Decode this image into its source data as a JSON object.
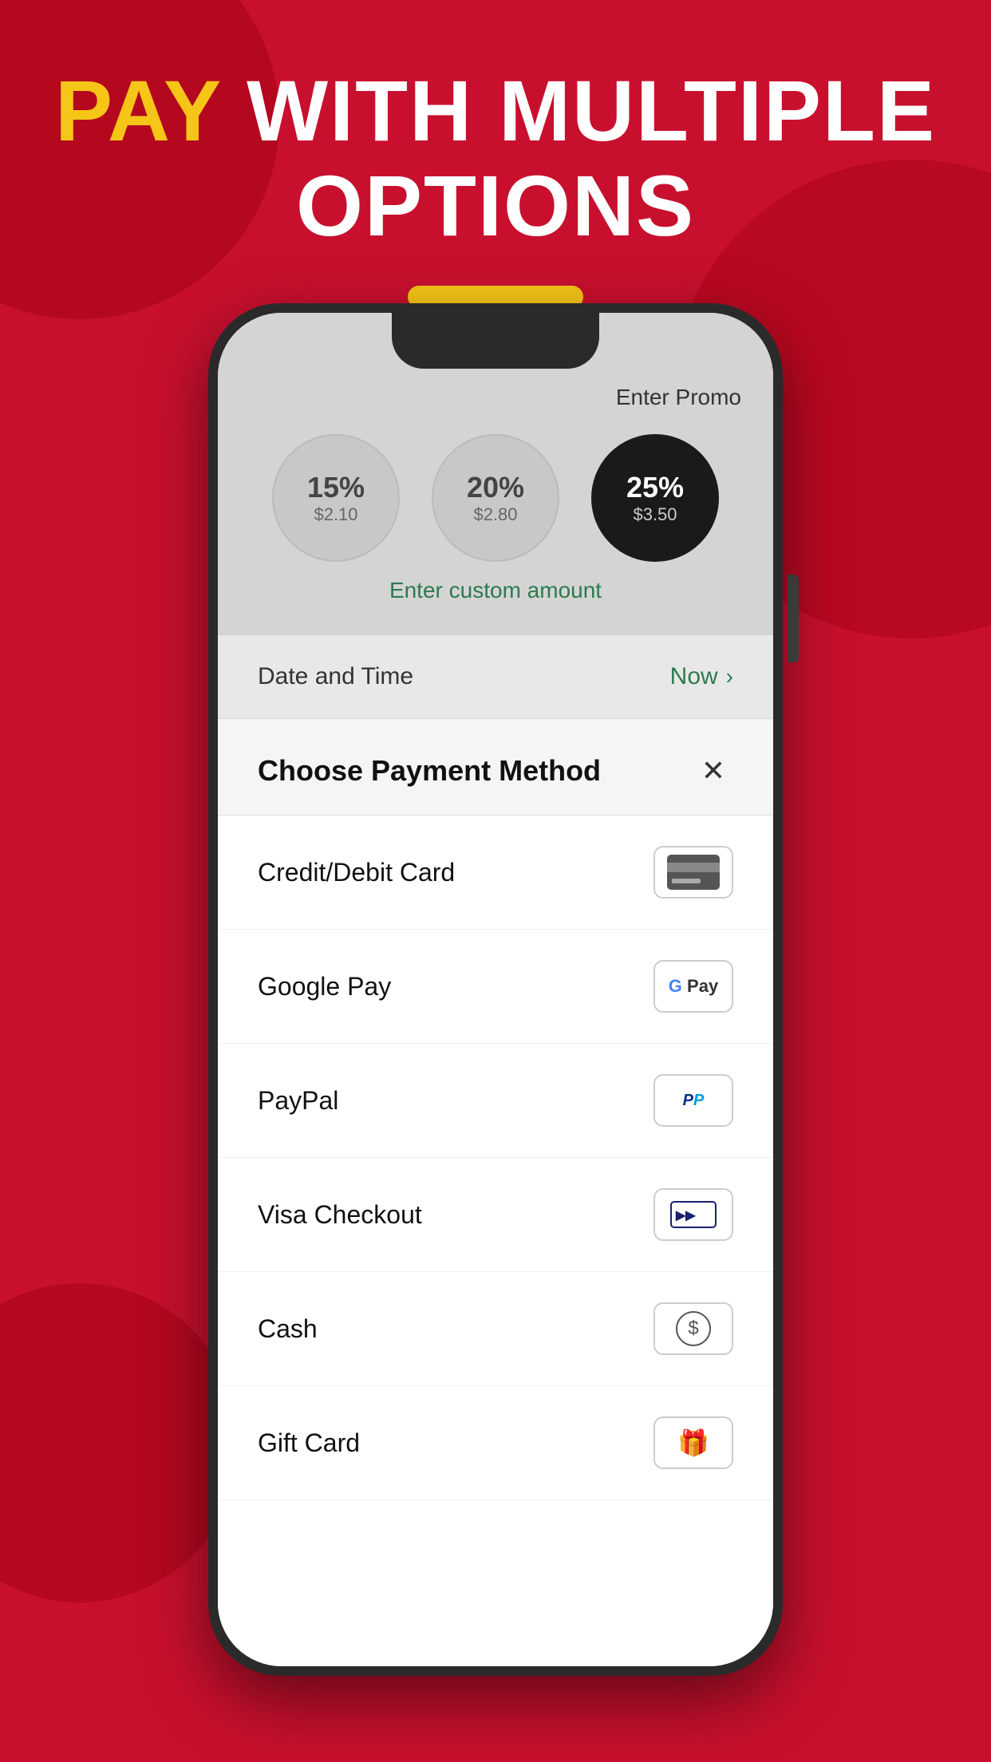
{
  "page": {
    "background_color": "#c8102e"
  },
  "header": {
    "pay_word": "PAY",
    "rest_of_title": " WITH MULTIPLE",
    "second_line": "OPTIONS"
  },
  "tip": {
    "promo_label": "Enter Promo",
    "custom_amount_label": "Enter custom amount",
    "options": [
      {
        "percent": "15%",
        "amount": "$2.10",
        "selected": false
      },
      {
        "percent": "20%",
        "amount": "$2.80",
        "selected": false
      },
      {
        "percent": "25%",
        "amount": "$3.50",
        "selected": true
      }
    ]
  },
  "datetime": {
    "label": "Date and Time",
    "value": "Now"
  },
  "payment_sheet": {
    "title": "Choose Payment Method",
    "close_icon": "✕",
    "methods": [
      {
        "label": "Credit/Debit Card",
        "icon_type": "credit-card"
      },
      {
        "label": "Google Pay",
        "icon_type": "google-pay"
      },
      {
        "label": "PayPal",
        "icon_type": "paypal"
      },
      {
        "label": "Visa Checkout",
        "icon_type": "visa"
      },
      {
        "label": "Cash",
        "icon_type": "cash"
      },
      {
        "label": "Gift Card",
        "icon_type": "gift"
      }
    ]
  }
}
